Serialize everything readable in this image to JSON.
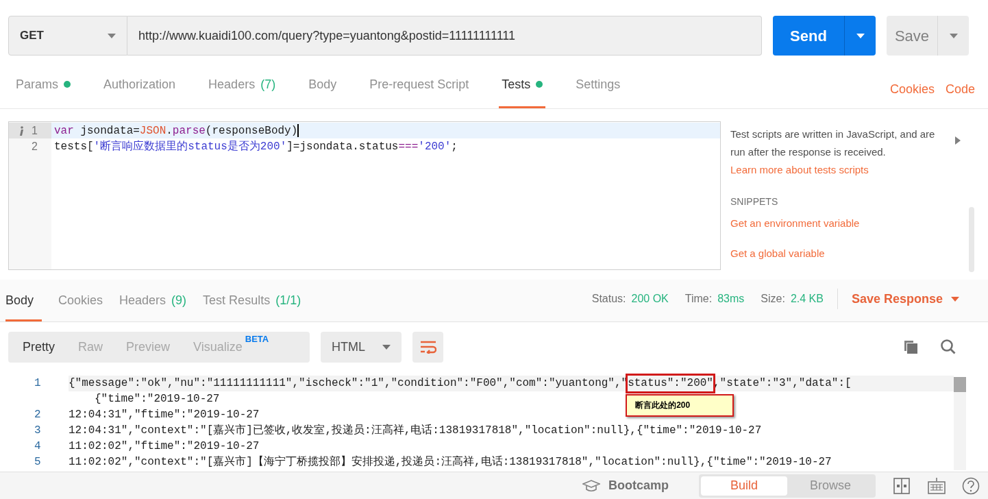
{
  "request": {
    "method": "GET",
    "url": "http://www.kuaidi100.com/query?type=yuantong&postid=11111111111",
    "send": "Send",
    "save": "Save"
  },
  "request_tabs": [
    {
      "label": "Params",
      "dot": true,
      "selected": false
    },
    {
      "label": "Authorization",
      "dot": false,
      "selected": false
    },
    {
      "label": "Headers",
      "count": "(7)",
      "dot": false,
      "selected": false
    },
    {
      "label": "Body",
      "dot": false,
      "selected": false
    },
    {
      "label": "Pre-request Script",
      "dot": false,
      "selected": false
    },
    {
      "label": "Tests",
      "dot": true,
      "selected": true
    },
    {
      "label": "Settings",
      "dot": false,
      "selected": false
    }
  ],
  "request_links": [
    "Cookies",
    "Code"
  ],
  "script_editor": {
    "lines": [
      {
        "number": "1",
        "current": true,
        "tokens": [
          {
            "kind": "keyword",
            "text": "var"
          },
          {
            "kind": "plain",
            "text": " jsondata="
          },
          {
            "kind": "builtin",
            "text": "JSON"
          },
          {
            "kind": "plain",
            "text": "."
          },
          {
            "kind": "keyword",
            "text": "parse"
          },
          {
            "kind": "plain",
            "text": "(responseBody)"
          }
        ]
      },
      {
        "number": "2",
        "current": false,
        "tokens": [
          {
            "kind": "plain",
            "text": "tests["
          },
          {
            "kind": "string",
            "text": "'断言响应数据里的status是否为200'"
          },
          {
            "kind": "plain",
            "text": "]=jsondata.status"
          },
          {
            "kind": "keyword",
            "text": "==="
          },
          {
            "kind": "string",
            "text": "'200'"
          },
          {
            "kind": "plain",
            "text": ";"
          }
        ]
      }
    ]
  },
  "snippets_panel": {
    "description": "Test scripts are written in JavaScript, and are run after the response is received.",
    "learn_more": "Learn more about tests scripts",
    "heading": "SNIPPETS",
    "snippets": [
      "Get an environment variable",
      "Get a global variable"
    ]
  },
  "response_tabs": [
    {
      "label": "Body",
      "selected": true
    },
    {
      "label": "Cookies",
      "selected": false
    },
    {
      "label": "Headers",
      "count": "(9)",
      "selected": false
    },
    {
      "label": "Test Results",
      "count": "(1/1)",
      "selected": false
    }
  ],
  "response_meta": [
    {
      "label": "Status:",
      "value": "200 OK"
    },
    {
      "label": "Time:",
      "value": "83ms"
    },
    {
      "label": "Size:",
      "value": "2.4 KB"
    }
  ],
  "save_response": "Save Response",
  "view_modes": [
    {
      "label": "Pretty",
      "selected": true
    },
    {
      "label": "Raw",
      "selected": false
    },
    {
      "label": "Preview",
      "selected": false
    },
    {
      "label": "Visualize",
      "badge": "BETA",
      "selected": false
    }
  ],
  "format": "HTML",
  "response_body": {
    "lines": [
      {
        "number": "1",
        "before": "{\"message\":\"ok\",\"nu\":\"11111111111\",\"ischeck\":\"1\",\"condition\":\"F00\",\"com\":\"yuantong\",\"",
        "marked": "status\":\"200\"",
        "after": ",\"state\":\"3\",\"data\":[",
        "continuation": "{\"time\":\"2019-10-27"
      },
      {
        "number": "2",
        "before": "12:04:31\",\"ftime\":\"2019-10-27"
      },
      {
        "number": "3",
        "before": "12:04:31\",\"context\":\"[嘉兴市]已签收,收发室,投递员:汪高祥,电话:13819317818\",\"location\":null},{\"time\":\"2019-10-27"
      },
      {
        "number": "4",
        "before": "11:02:02\",\"ftime\":\"2019-10-27"
      },
      {
        "number": "5",
        "before": "11:02:02\",\"context\":\"[嘉兴市]【海宁丁桥揽投部】安排投递,投递员:汪高祥,电话:13819317818\",\"location\":null},{\"time\":\"2019-10-27"
      }
    ],
    "annotation": "断言此处的200"
  },
  "footer": {
    "bootcamp": "Bootcamp",
    "modes": [
      {
        "label": "Build",
        "selected": true
      },
      {
        "label": "Browse",
        "selected": false
      }
    ]
  }
}
